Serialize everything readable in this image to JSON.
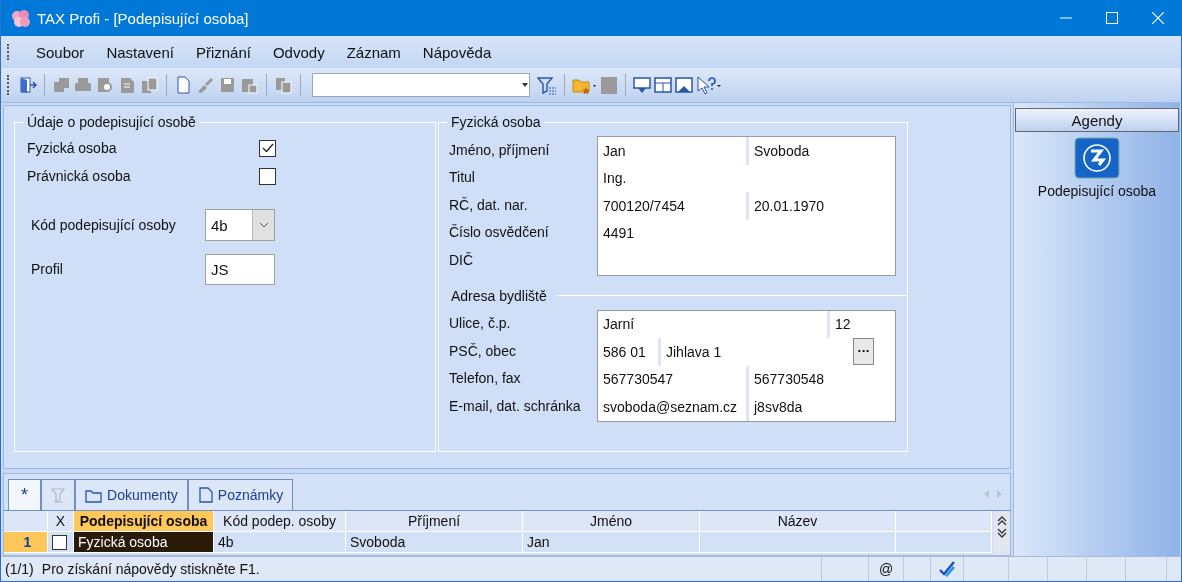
{
  "window": {
    "title": "TAX Profi - [Podepisující osoba]"
  },
  "menu": [
    {
      "label": "Soubor"
    },
    {
      "label": "Nastavení"
    },
    {
      "label": "Přiznání"
    },
    {
      "label": "Odvody"
    },
    {
      "label": "Záznam"
    },
    {
      "label": "Nápověda"
    }
  ],
  "toolbar": {
    "left": [
      {
        "disabled": false
      },
      {
        "disabled": true
      },
      {
        "disabled": true
      },
      {
        "disabled": true
      },
      {
        "disabled": true
      },
      {
        "disabled": true
      },
      {
        "disabled": false
      },
      {
        "disabled": true
      },
      {
        "disabled": true
      },
      {
        "disabled": true
      },
      {
        "disabled": true
      }
    ],
    "right": [
      {
        "disabled": false
      },
      {
        "disabled": false
      },
      {
        "disabled": true
      },
      {
        "disabled": false
      },
      {
        "disabled": false
      },
      {
        "disabled": false
      },
      {
        "disabled": false
      }
    ]
  },
  "signer_group": {
    "title": "Údaje o podepisující osobě",
    "checks": [
      {
        "label": "Fyzická osoba",
        "checked": true
      },
      {
        "label": "Právnická osoba",
        "checked": false
      }
    ],
    "code": {
      "label": "Kód podepisující osoby",
      "value": "4b"
    },
    "profile": {
      "label": "Profil",
      "value": "JS"
    }
  },
  "person_group": {
    "title": "Fyzická osoba",
    "rows": [
      {
        "label": "Jméno, příjmení",
        "kind": "pair",
        "values": [
          "Jan",
          "Svoboda"
        ]
      },
      {
        "label": "Titul",
        "kind": "single",
        "values": [
          "Ing."
        ]
      },
      {
        "label": "RČ, dat. nar.",
        "kind": "pair",
        "values": [
          "700120/7454",
          "20.01.1970"
        ]
      },
      {
        "label": "Číslo osvědčení",
        "kind": "single",
        "values": [
          "4491"
        ]
      },
      {
        "label": "DIČ",
        "kind": "single",
        "values": []
      }
    ]
  },
  "address_group": {
    "title": "Adresa bydliště",
    "rows": [
      {
        "label": "Ulice, č.p.",
        "kind": "street",
        "values": [
          "Jarní",
          "12"
        ]
      },
      {
        "label": "PSČ, obec",
        "kind": "city",
        "values": [
          "586 01",
          "Jihlava 1"
        ],
        "button": "···"
      },
      {
        "label": "Telefon, fax",
        "kind": "pair",
        "values": [
          "567730547",
          "567730548"
        ]
      },
      {
        "label": "E-mail, dat. schránka",
        "kind": "pair",
        "values": [
          "svoboda@seznam.cz",
          "j8sv8da"
        ]
      }
    ]
  },
  "agenda_panel": {
    "title": "Agendy",
    "items": [
      {
        "label": "Podepisující osoba",
        "selected": true
      }
    ]
  },
  "bottom_tabs": [
    {
      "label": "*",
      "kind": "text",
      "selected": true
    },
    {
      "kind": "filter",
      "selected": false,
      "disabled": true
    },
    {
      "label": "Dokumenty",
      "kind": "folder",
      "selected": false
    },
    {
      "label": "Poznámky",
      "kind": "note",
      "selected": false
    }
  ],
  "table": {
    "check_column": "X",
    "columns": [
      {
        "label": "Podepisující osoba",
        "sorted": true
      },
      {
        "label": "Kód podep. osoby",
        "sorted": false
      },
      {
        "label": "Příjmení",
        "sorted": false
      },
      {
        "label": "Jméno",
        "sorted": false
      },
      {
        "label": "Název",
        "sorted": false
      }
    ],
    "rows": [
      {
        "number": "1",
        "checked": false,
        "cells": [
          "Fyzická osoba",
          "4b",
          "Svoboda",
          "Jan",
          ""
        ],
        "selected": true
      }
    ]
  },
  "status_bar": {
    "position": "(1/1)",
    "message": "Pro získání nápovědy stiskněte F1.",
    "at": "@"
  }
}
